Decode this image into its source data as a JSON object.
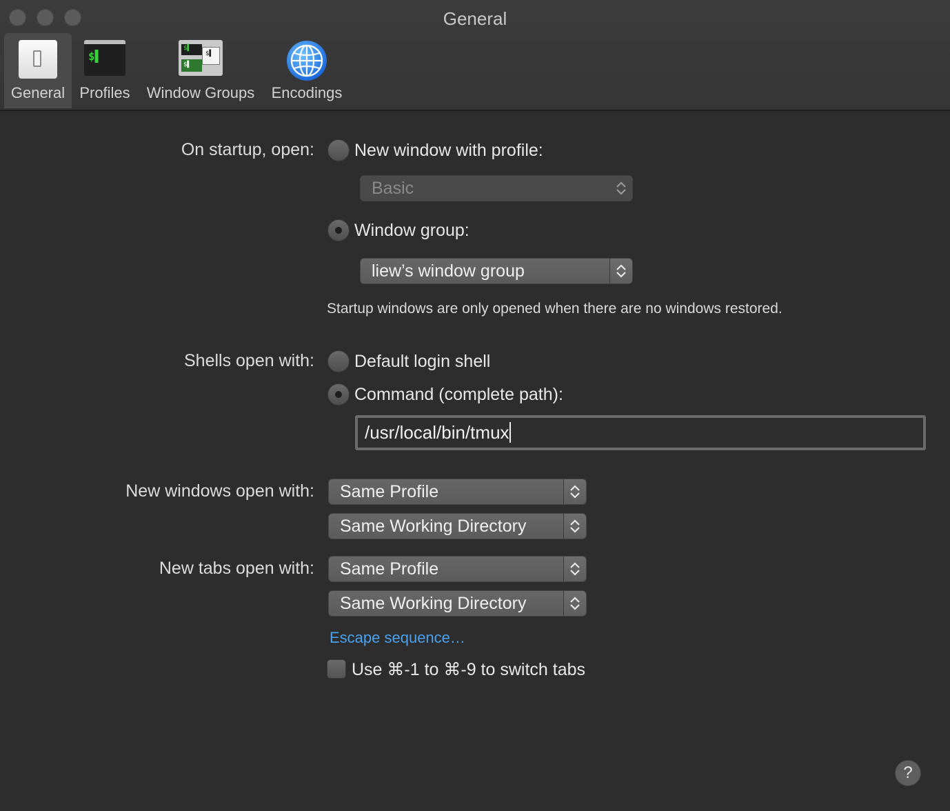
{
  "window": {
    "title": "General"
  },
  "toolbar": {
    "tabs": [
      {
        "label": "General",
        "icon": "general-prefs-icon",
        "active": true
      },
      {
        "label": "Profiles",
        "icon": "terminal-profile-icon",
        "active": false
      },
      {
        "label": "Window Groups",
        "icon": "window-groups-icon",
        "active": false
      },
      {
        "label": "Encodings",
        "icon": "globe-icon",
        "active": false
      }
    ]
  },
  "startup": {
    "label": "On startup, open:",
    "option_new_window": "New window with profile:",
    "profile_popup": "Basic",
    "option_window_group": "Window group:",
    "window_group_popup": "liew’s window group",
    "selected": "window_group",
    "note": "Startup windows are only opened when there are no windows restored."
  },
  "shells": {
    "label": "Shells open with:",
    "option_default": "Default login shell",
    "option_command": "Command (complete path):",
    "selected": "command",
    "command_value": "/usr/local/bin/tmux"
  },
  "new_windows": {
    "label": "New windows open with:",
    "profile_popup": "Same Profile",
    "directory_popup": "Same Working Directory"
  },
  "new_tabs": {
    "label": "New tabs open with:",
    "profile_popup": "Same Profile",
    "directory_popup": "Same Working Directory"
  },
  "escape_link": "Escape sequence…",
  "switch_tabs_checkbox": {
    "label": "Use ⌘-1 to ⌘-9 to switch tabs",
    "checked": false
  },
  "help_button": "?"
}
